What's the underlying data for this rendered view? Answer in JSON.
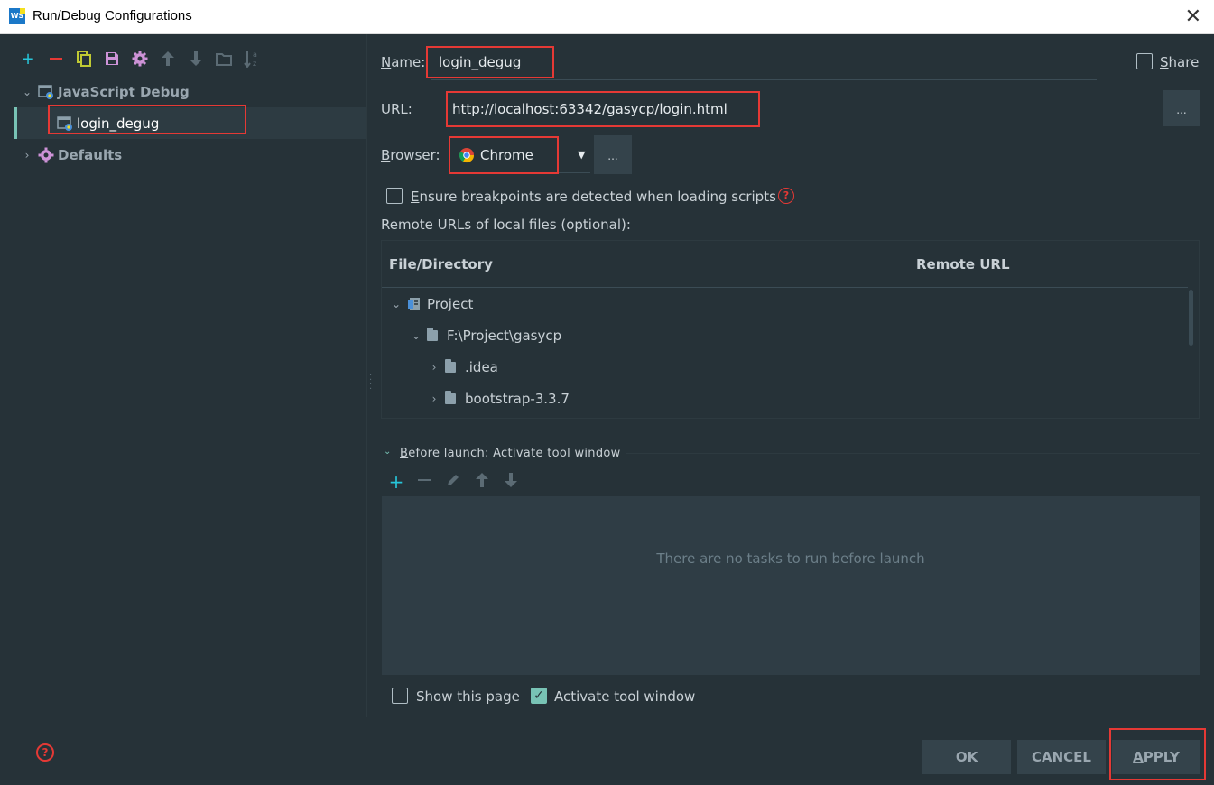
{
  "window": {
    "app_icon_text": "WS",
    "title": "Run/Debug Configurations",
    "close_glyph": "✕"
  },
  "left_toolbar": {
    "icons": [
      "plus-icon",
      "minus-icon",
      "copy-icon",
      "save-icon",
      "gear-icon",
      "arrow-up-icon",
      "arrow-down-icon",
      "folder-icon",
      "sort-az-icon"
    ],
    "colors": {
      "plus": "#26c6da",
      "minus": "#e53935",
      "copy": "#c0ca33",
      "save": "#ce93d8",
      "gear": "#ce93d8",
      "disabled": "#5b6b74"
    }
  },
  "tree": {
    "groups": [
      {
        "label": "JavaScript Debug",
        "expanded": true,
        "children": [
          {
            "label": "login_degug",
            "selected": true
          }
        ]
      },
      {
        "label": "Defaults",
        "expanded": false
      }
    ]
  },
  "form": {
    "name_label_prefix": "N",
    "name_label_rest": "ame:",
    "name_value": "login_degug",
    "share_label_prefix": "S",
    "share_label_rest": "hare",
    "url_label": "URL:",
    "url_value": "http://localhost:63342/gasycp/login.html",
    "url_button": "...",
    "browser_label_prefix": "B",
    "browser_label_rest": "rowser:",
    "browser_value": "Chrome",
    "browser_button": "...",
    "ensure_label_prefix": "E",
    "ensure_label_rest": "nsure breakpoints are detected when loading scripts",
    "remote_urls_label": "Remote URLs of local files (optional):"
  },
  "remote_table": {
    "columns": [
      "File/Directory",
      "Remote URL"
    ],
    "rows": [
      {
        "label": "Project",
        "indent": 0,
        "expanded": true,
        "icon": "project-icon"
      },
      {
        "label": "F:\\Project\\gasycp",
        "indent": 1,
        "expanded": true,
        "icon": "folder-icon"
      },
      {
        "label": ".idea",
        "indent": 2,
        "expanded": false,
        "icon": "folder-icon"
      },
      {
        "label": "bootstrap-3.3.7",
        "indent": 2,
        "expanded": false,
        "icon": "folder-icon"
      }
    ]
  },
  "before_launch": {
    "title_prefix": "B",
    "title_rest": "efore launch: Activate tool window",
    "empty_text": "There are no tasks to run before launch",
    "show_page_label": "Show this page",
    "show_page_checked": false,
    "activate_label": "Activate tool window",
    "activate_checked": true
  },
  "buttons": {
    "ok": "OK",
    "cancel": "CANCEL",
    "apply_prefix": "A",
    "apply_rest": "PPLY"
  },
  "help_glyph": "?"
}
